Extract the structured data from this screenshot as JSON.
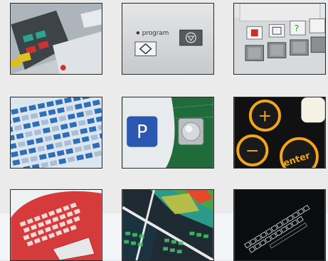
{
  "grid": {
    "tiles": [
      {
        "name": "tile-membrane-keypad-grey",
        "caption": ""
      },
      {
        "name": "tile-program-buttons",
        "caption": ""
      },
      {
        "name": "tile-icon-keys",
        "caption": ""
      },
      {
        "name": "tile-blue-keyboard",
        "caption": ""
      },
      {
        "name": "tile-p-key-metal-dome",
        "caption": ""
      },
      {
        "name": "tile-backlit-plus-minus-enter",
        "caption": ""
      },
      {
        "name": "tile-red-keyboard",
        "caption": ""
      },
      {
        "name": "tile-colorful-circuit",
        "caption": ""
      },
      {
        "name": "tile-dark-backlit-keyboard",
        "caption": ""
      }
    ]
  },
  "labels": {
    "program": "program",
    "p_key": "P",
    "plus": "+",
    "minus": "−",
    "enter": "enter"
  },
  "colors": {
    "page_bg": "#ebebeb",
    "tile_border": "#2a2a2a",
    "keypad_blue": "#2f6fb6",
    "backlight_orange": "#f2a51b",
    "membrane_red": "#d63b3b"
  }
}
